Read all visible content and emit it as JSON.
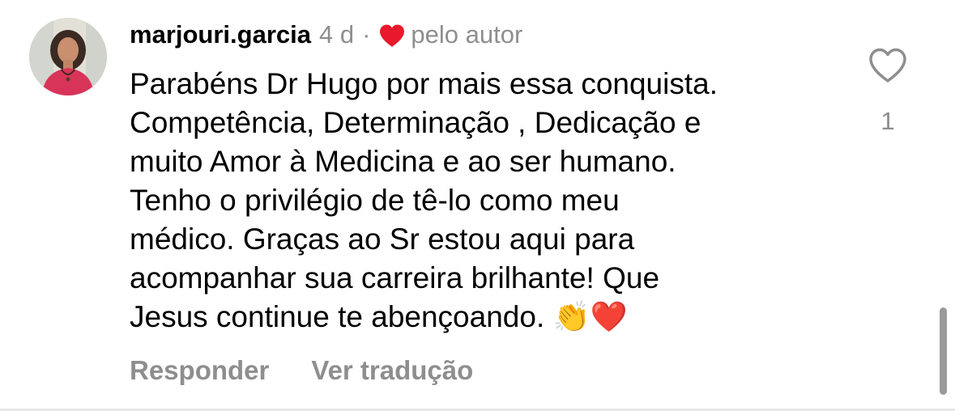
{
  "comment": {
    "username": "marjouri.garcia",
    "time": "4 d",
    "separator": "·",
    "author_badge": "pelo autor",
    "text": "Parabéns Dr Hugo por mais essa conquista.\nCompetência, Determinação , Dedicação e\nmuito Amor à Medicina e ao ser humano.\nTenho o privilégio de tê-lo como meu\nmédico. Graças ao Sr estou aqui para\nacompanhar sua carreira brilhante! Que\nJesus continue te abençoando. 👏❤️",
    "like_count": "1",
    "reply_label": "Responder",
    "translate_label": "Ver tradução"
  },
  "icons": {
    "avatar": "avatar-photo",
    "author_heart": "heart-filled-icon",
    "like": "heart-outline-icon"
  },
  "colors": {
    "text": "#000000",
    "secondary": "#8e8e8e",
    "heart_red": "#e8192c",
    "scrollbar": "#9a9a9a"
  }
}
